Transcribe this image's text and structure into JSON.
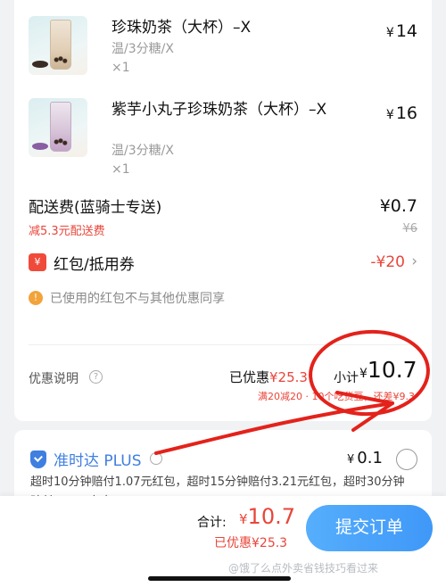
{
  "items": [
    {
      "name": "珍珠奶茶（大杯）–X",
      "options": "温/3分糖/X",
      "qty": "×1",
      "currency": "¥",
      "price": "14",
      "thumb_icon": "milk-tea-icon"
    },
    {
      "name": "紫芋小丸子珍珠奶茶（大杯）–X",
      "options": "温/3分糖/X",
      "qty": "×1",
      "currency": "¥",
      "price": "16",
      "thumb_icon": "taro-milk-tea-icon"
    }
  ],
  "delivery": {
    "label": "配送费(蓝骑士专送)",
    "sub": "减5.3元配送费",
    "price": "¥0.7",
    "original": "¥6"
  },
  "coupon": {
    "icon_text": "¥",
    "label": "红包/抵用券",
    "amount": "-¥20",
    "chevron": "›"
  },
  "notice": {
    "icon_text": "!",
    "text": "已使用的红包不与其他优惠同享"
  },
  "summary": {
    "discount_label": "优惠说明",
    "help_text": "?",
    "already_label": "已优惠",
    "already_amount": "¥25.3",
    "subtotal_label": "小计",
    "subtotal_currency": "¥",
    "subtotal_value": "10.7",
    "discount_detail": "满20减20 · 10个吃货豆，还差¥9.3"
  },
  "plus": {
    "title": "准时达 PLUS",
    "currency": "¥",
    "price": "0.1",
    "description": "超时10分钟赔付1.07元红包，超时15分钟赔付3.21元红包，超时30分钟赔付4.28元红包"
  },
  "bottom": {
    "total_label": "合计:",
    "total_currency": "¥",
    "total_value": "10.7",
    "saved": "已优惠¥25.3",
    "submit_label": "提交订单",
    "watermark": "@饿了么点外卖省钱技巧看过来"
  },
  "colors": {
    "accent_red": "#e8463a",
    "accent_blue": "#3f98f8",
    "annotation_red": "#e3221b"
  }
}
